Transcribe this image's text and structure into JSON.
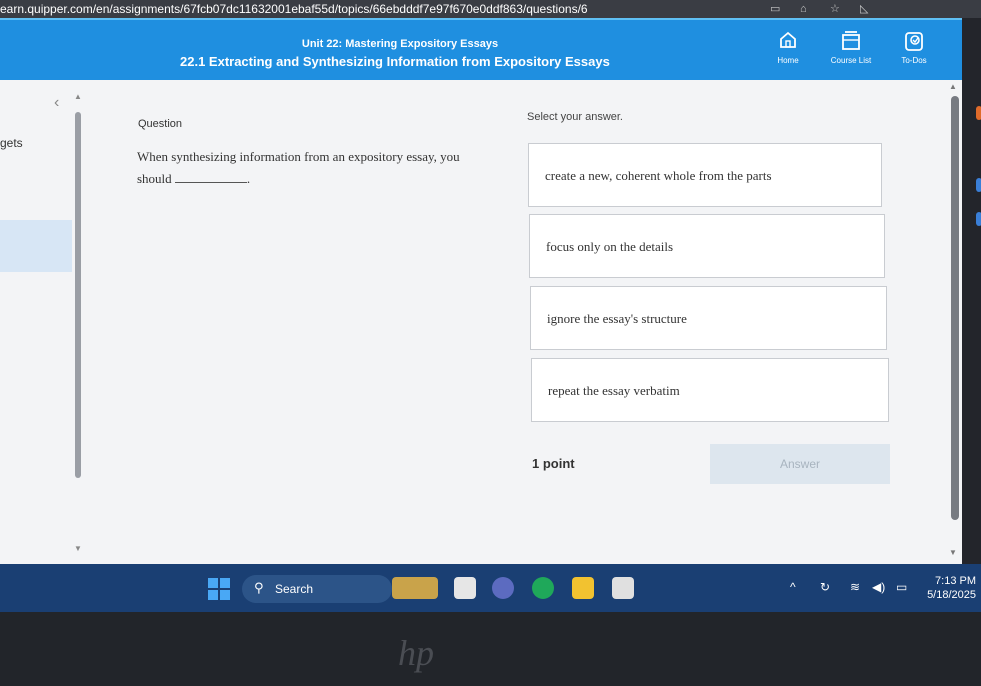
{
  "browser": {
    "url": "earn.quipper.com/en/assignments/67fcb07dc11632001ebaf55d/topics/66ebdddf7e97f670e0ddf863/questions/6"
  },
  "header": {
    "unit_title": "Unit 22: Mastering Expository Essays",
    "lesson_title": "22.1 Extracting and Synthesizing Information from Expository Essays",
    "nav": [
      {
        "label": "Home",
        "icon": "home-icon"
      },
      {
        "label": "Course List",
        "icon": "course-list-icon"
      },
      {
        "label": "To-Dos",
        "icon": "todos-icon"
      }
    ],
    "color": "#1f8fe0"
  },
  "left_panel": {
    "partial_text": "gets"
  },
  "question": {
    "label": "Question",
    "text_before": "When synthesizing information from an expository essay, you should",
    "text_after": "."
  },
  "answers": {
    "prompt": "Select your answer.",
    "choices": [
      "create a new, coherent whole from the parts",
      "focus only on the details",
      "ignore the essay's structure",
      "repeat the essay verbatim"
    ],
    "points": "1 point",
    "submit_label": "Answer"
  },
  "taskbar": {
    "search_label": "Search",
    "time": "7:13 PM",
    "date": "5/18/2025"
  },
  "device": {
    "logo": "hp"
  }
}
